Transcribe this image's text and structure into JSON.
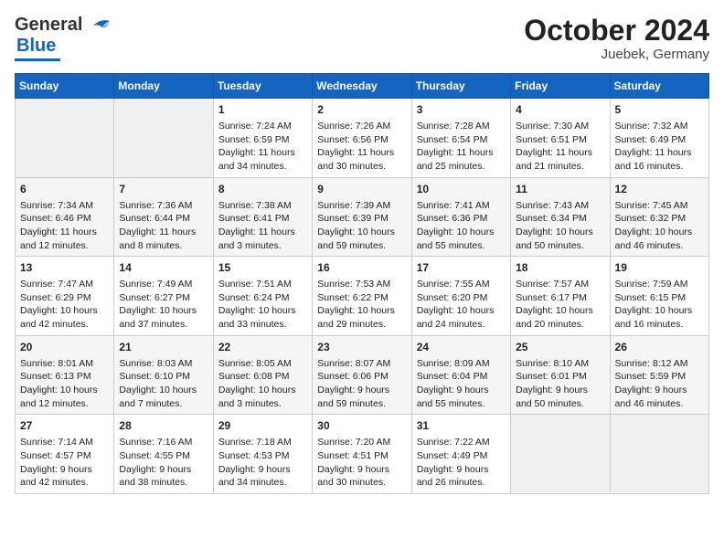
{
  "header": {
    "logo_general": "General",
    "logo_blue": "Blue",
    "month_title": "October 2024",
    "subtitle": "Juebek, Germany"
  },
  "days_of_week": [
    "Sunday",
    "Monday",
    "Tuesday",
    "Wednesday",
    "Thursday",
    "Friday",
    "Saturday"
  ],
  "weeks": [
    {
      "days": [
        {
          "num": "",
          "content": ""
        },
        {
          "num": "",
          "content": ""
        },
        {
          "num": "1",
          "content": "Sunrise: 7:24 AM\nSunset: 6:59 PM\nDaylight: 11 hours\nand 34 minutes."
        },
        {
          "num": "2",
          "content": "Sunrise: 7:26 AM\nSunset: 6:56 PM\nDaylight: 11 hours\nand 30 minutes."
        },
        {
          "num": "3",
          "content": "Sunrise: 7:28 AM\nSunset: 6:54 PM\nDaylight: 11 hours\nand 25 minutes."
        },
        {
          "num": "4",
          "content": "Sunrise: 7:30 AM\nSunset: 6:51 PM\nDaylight: 11 hours\nand 21 minutes."
        },
        {
          "num": "5",
          "content": "Sunrise: 7:32 AM\nSunset: 6:49 PM\nDaylight: 11 hours\nand 16 minutes."
        }
      ]
    },
    {
      "days": [
        {
          "num": "6",
          "content": "Sunrise: 7:34 AM\nSunset: 6:46 PM\nDaylight: 11 hours\nand 12 minutes."
        },
        {
          "num": "7",
          "content": "Sunrise: 7:36 AM\nSunset: 6:44 PM\nDaylight: 11 hours\nand 8 minutes."
        },
        {
          "num": "8",
          "content": "Sunrise: 7:38 AM\nSunset: 6:41 PM\nDaylight: 11 hours\nand 3 minutes."
        },
        {
          "num": "9",
          "content": "Sunrise: 7:39 AM\nSunset: 6:39 PM\nDaylight: 10 hours\nand 59 minutes."
        },
        {
          "num": "10",
          "content": "Sunrise: 7:41 AM\nSunset: 6:36 PM\nDaylight: 10 hours\nand 55 minutes."
        },
        {
          "num": "11",
          "content": "Sunrise: 7:43 AM\nSunset: 6:34 PM\nDaylight: 10 hours\nand 50 minutes."
        },
        {
          "num": "12",
          "content": "Sunrise: 7:45 AM\nSunset: 6:32 PM\nDaylight: 10 hours\nand 46 minutes."
        }
      ]
    },
    {
      "days": [
        {
          "num": "13",
          "content": "Sunrise: 7:47 AM\nSunset: 6:29 PM\nDaylight: 10 hours\nand 42 minutes."
        },
        {
          "num": "14",
          "content": "Sunrise: 7:49 AM\nSunset: 6:27 PM\nDaylight: 10 hours\nand 37 minutes."
        },
        {
          "num": "15",
          "content": "Sunrise: 7:51 AM\nSunset: 6:24 PM\nDaylight: 10 hours\nand 33 minutes."
        },
        {
          "num": "16",
          "content": "Sunrise: 7:53 AM\nSunset: 6:22 PM\nDaylight: 10 hours\nand 29 minutes."
        },
        {
          "num": "17",
          "content": "Sunrise: 7:55 AM\nSunset: 6:20 PM\nDaylight: 10 hours\nand 24 minutes."
        },
        {
          "num": "18",
          "content": "Sunrise: 7:57 AM\nSunset: 6:17 PM\nDaylight: 10 hours\nand 20 minutes."
        },
        {
          "num": "19",
          "content": "Sunrise: 7:59 AM\nSunset: 6:15 PM\nDaylight: 10 hours\nand 16 minutes."
        }
      ]
    },
    {
      "days": [
        {
          "num": "20",
          "content": "Sunrise: 8:01 AM\nSunset: 6:13 PM\nDaylight: 10 hours\nand 12 minutes."
        },
        {
          "num": "21",
          "content": "Sunrise: 8:03 AM\nSunset: 6:10 PM\nDaylight: 10 hours\nand 7 minutes."
        },
        {
          "num": "22",
          "content": "Sunrise: 8:05 AM\nSunset: 6:08 PM\nDaylight: 10 hours\nand 3 minutes."
        },
        {
          "num": "23",
          "content": "Sunrise: 8:07 AM\nSunset: 6:06 PM\nDaylight: 9 hours\nand 59 minutes."
        },
        {
          "num": "24",
          "content": "Sunrise: 8:09 AM\nSunset: 6:04 PM\nDaylight: 9 hours\nand 55 minutes."
        },
        {
          "num": "25",
          "content": "Sunrise: 8:10 AM\nSunset: 6:01 PM\nDaylight: 9 hours\nand 50 minutes."
        },
        {
          "num": "26",
          "content": "Sunrise: 8:12 AM\nSunset: 5:59 PM\nDaylight: 9 hours\nand 46 minutes."
        }
      ]
    },
    {
      "days": [
        {
          "num": "27",
          "content": "Sunrise: 7:14 AM\nSunset: 4:57 PM\nDaylight: 9 hours\nand 42 minutes."
        },
        {
          "num": "28",
          "content": "Sunrise: 7:16 AM\nSunset: 4:55 PM\nDaylight: 9 hours\nand 38 minutes."
        },
        {
          "num": "29",
          "content": "Sunrise: 7:18 AM\nSunset: 4:53 PM\nDaylight: 9 hours\nand 34 minutes."
        },
        {
          "num": "30",
          "content": "Sunrise: 7:20 AM\nSunset: 4:51 PM\nDaylight: 9 hours\nand 30 minutes."
        },
        {
          "num": "31",
          "content": "Sunrise: 7:22 AM\nSunset: 4:49 PM\nDaylight: 9 hours\nand 26 minutes."
        },
        {
          "num": "",
          "content": ""
        },
        {
          "num": "",
          "content": ""
        }
      ]
    }
  ]
}
